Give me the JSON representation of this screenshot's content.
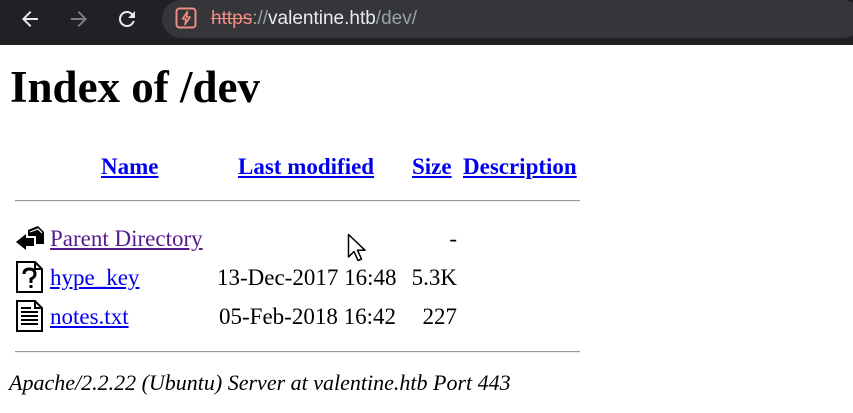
{
  "browser": {
    "url": {
      "scheme": "https",
      "separator": "://",
      "host": "valentine.htb",
      "path": "/dev/"
    },
    "icons": {
      "back": "arrow-left-icon",
      "forward": "arrow-right-icon",
      "reload": "reload-icon",
      "security": "not-secure-warning-icon"
    }
  },
  "page": {
    "title": "Index of /dev",
    "columns": {
      "name": "Name",
      "last_modified": "Last modified",
      "size": "Size",
      "description": "Description"
    },
    "rows": [
      {
        "icon": "back-folder-icon",
        "name": "Parent Directory",
        "modified": "",
        "size": "-",
        "description": ""
      },
      {
        "icon": "unknown-file-icon",
        "name": "hype_key",
        "modified": "13-Dec-2017 16:48",
        "size": "5.3K",
        "description": ""
      },
      {
        "icon": "text-file-icon",
        "name": "notes.txt",
        "modified": "05-Feb-2018 16:42",
        "size": "227",
        "description": ""
      }
    ],
    "address": "Apache/2.2.22 (Ubuntu) Server at valentine.htb Port 443"
  },
  "colors": {
    "chrome_bg": "#202124",
    "omnibox_bg": "#35363a",
    "link": "#0000ee",
    "visited_link": "#551a8b",
    "insecure_scheme": "#f28b82"
  }
}
